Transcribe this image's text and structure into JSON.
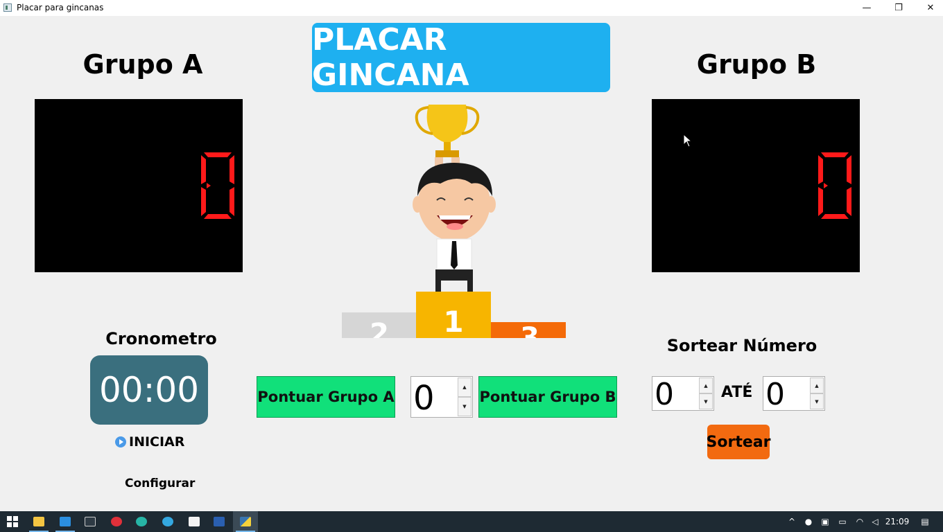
{
  "window": {
    "title": "Placar para gincanas",
    "minimize_glyph": "—",
    "restore_glyph": "❐",
    "close_glyph": "✕"
  },
  "header": {
    "title": "PLACAR GINCANA"
  },
  "group_a": {
    "title": "Grupo A",
    "score": 0
  },
  "group_b": {
    "title": "Grupo B",
    "score": 0
  },
  "colors": {
    "header_button": "#1eb0f0",
    "score_panel": "#000000",
    "score_digit": "#ff1a1a",
    "timer_bg": "#3a6f7e",
    "green_button": "#11e07a",
    "orange_button": "#f26a10",
    "taskbar": "#1e2a33"
  },
  "stopwatch": {
    "title": "Cronometro",
    "time": "00:00",
    "start_label": "INICIAR",
    "config_label": "Configurar"
  },
  "scoring": {
    "button_a": "Pontuar Grupo A",
    "points_value": "0",
    "button_b": "Pontuar Grupo B"
  },
  "draw": {
    "title": "Sortear Número",
    "from_value": "0",
    "to_label": "ATÉ",
    "to_value": "0",
    "button": "Sortear"
  },
  "podium": {
    "second": "2",
    "first": "1",
    "third": "3"
  },
  "taskbar": {
    "apps": [
      "start-icon",
      "file-explorer-icon",
      "vscode-icon",
      "terminal-icon",
      "devexpress-icon",
      "edge-icon",
      "telegram-icon",
      "office-icon",
      "powershell-icon",
      "python-icon"
    ],
    "clock": "21:09"
  }
}
